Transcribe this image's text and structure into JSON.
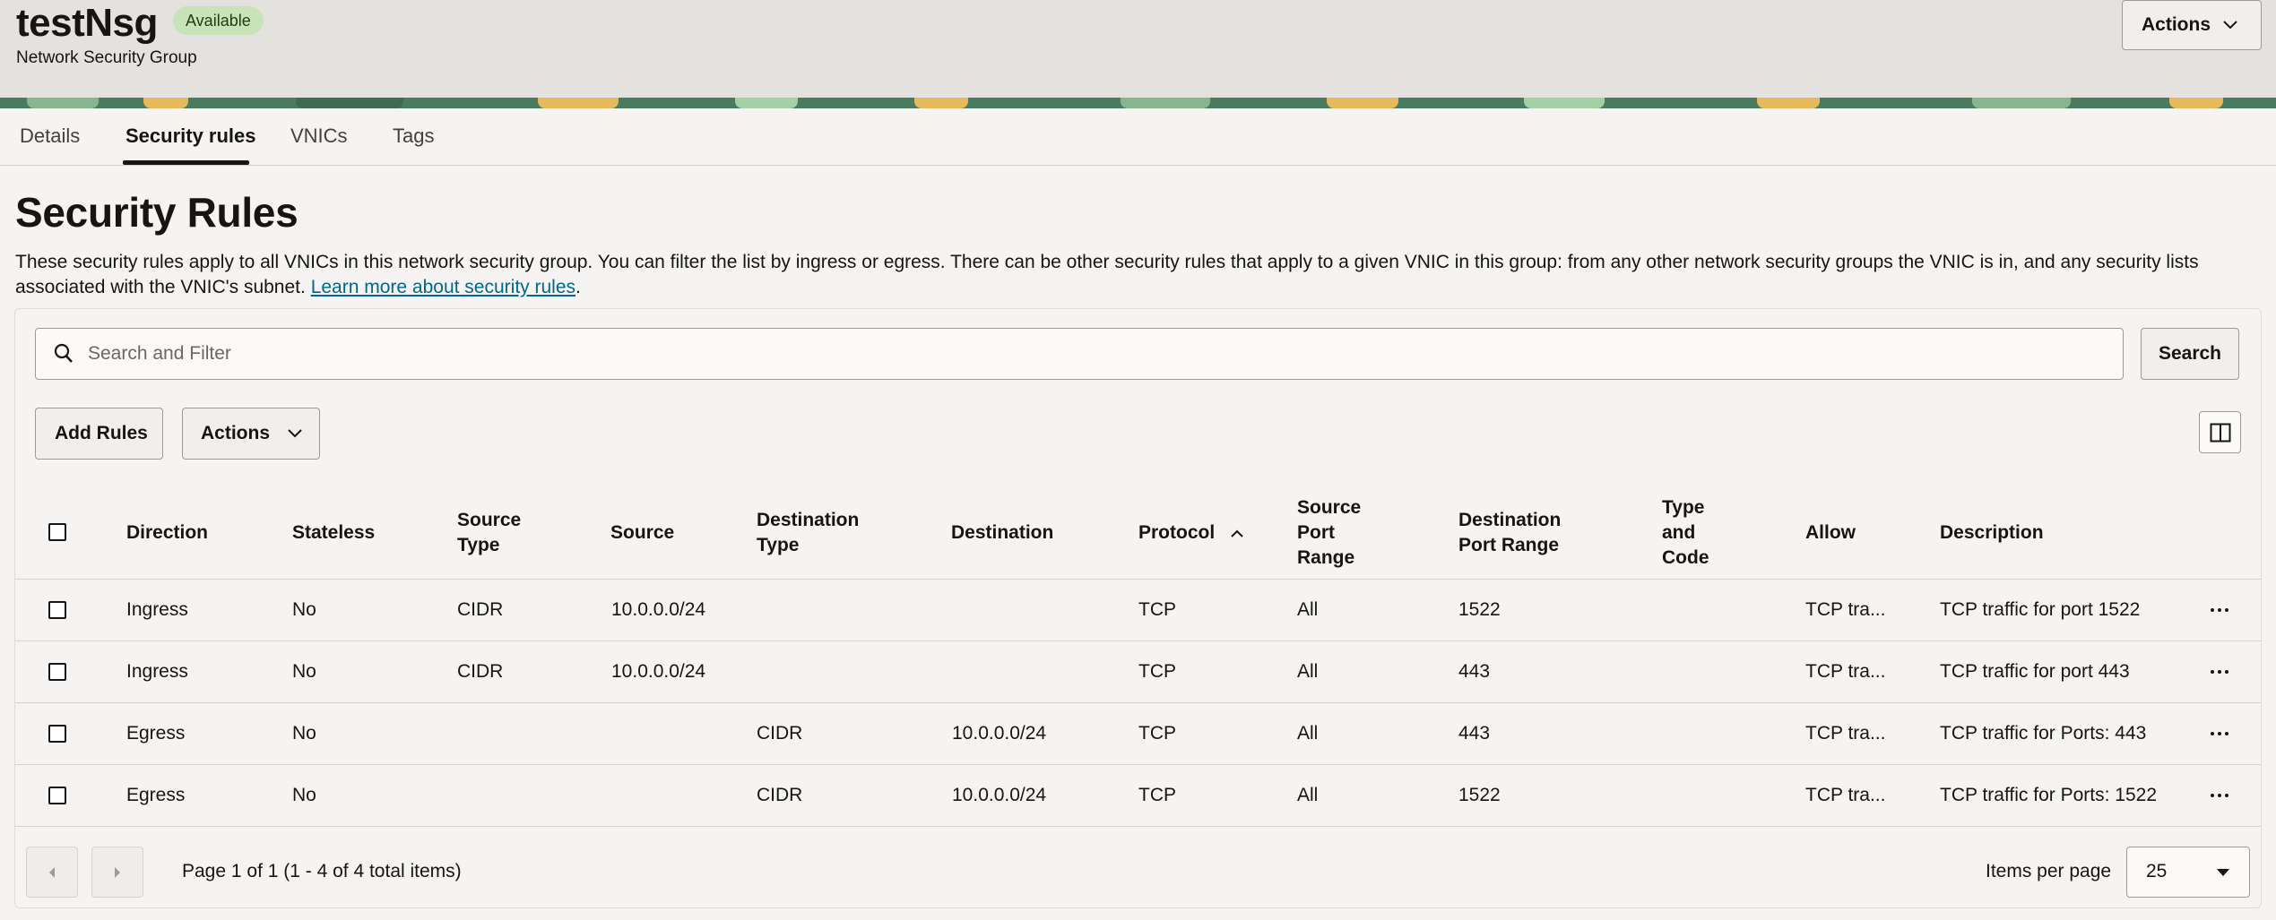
{
  "header": {
    "title": "testNsg",
    "status": "Available",
    "subtitle": "Network Security Group",
    "actions_label": "Actions"
  },
  "tabs": [
    {
      "label": "Details",
      "active": false
    },
    {
      "label": "Security rules",
      "active": true
    },
    {
      "label": "VNICs",
      "active": false
    },
    {
      "label": "Tags",
      "active": false
    }
  ],
  "section": {
    "title": "Security Rules",
    "description": "These security rules apply to all VNICs in this network security group. You can filter the list by ingress or egress. There can be other security rules that apply to a given VNIC in this group: from any other network security groups the VNIC is in, and any security lists associated with the VNIC's subnet.",
    "link_text": "Learn more about security rules",
    "after_link": "."
  },
  "search": {
    "placeholder": "Search and Filter",
    "value": "",
    "button_label": "Search",
    "icon": "search-icon"
  },
  "toolbar": {
    "add_rules_label": "Add Rules",
    "actions_label": "Actions",
    "columns_icon": "columns-icon"
  },
  "table": {
    "columns": {
      "direction": "Direction",
      "stateless": "Stateless",
      "source_type_1": "Source",
      "source_type_2": "Type",
      "source": "Source",
      "dest_type_1": "Destination",
      "dest_type_2": "Type",
      "destination": "Destination",
      "protocol": "Protocol",
      "src_port_1": "Source",
      "src_port_2": "Port",
      "src_port_3": "Range",
      "dst_port_1": "Destination",
      "dst_port_2": "Port Range",
      "type_code_1": "Type",
      "type_code_2": "and",
      "type_code_3": "Code",
      "allow": "Allow",
      "description": "Description"
    },
    "sort": {
      "column": "Protocol",
      "direction": "ascending"
    },
    "rows": [
      {
        "direction": "Ingress",
        "stateless": "No",
        "source_type": "CIDR",
        "source": "10.0.0.0/24",
        "dest_type": "",
        "destination": "",
        "protocol": "TCP",
        "src_port": "All",
        "dst_port": "1522",
        "type_code": "",
        "allow": "TCP tra...",
        "description": "TCP traffic for port 1522"
      },
      {
        "direction": "Ingress",
        "stateless": "No",
        "source_type": "CIDR",
        "source": "10.0.0.0/24",
        "dest_type": "",
        "destination": "",
        "protocol": "TCP",
        "src_port": "All",
        "dst_port": "443",
        "type_code": "",
        "allow": "TCP tra...",
        "description": "TCP traffic for port 443"
      },
      {
        "direction": "Egress",
        "stateless": "No",
        "source_type": "",
        "source": "",
        "dest_type": "CIDR",
        "destination": "10.0.0.0/24",
        "protocol": "TCP",
        "src_port": "All",
        "dst_port": "443",
        "type_code": "",
        "allow": "TCP tra...",
        "description": "TCP traffic for Ports: 443"
      },
      {
        "direction": "Egress",
        "stateless": "No",
        "source_type": "",
        "source": "",
        "dest_type": "CIDR",
        "destination": "10.0.0.0/24",
        "protocol": "TCP",
        "src_port": "All",
        "dst_port": "1522",
        "type_code": "",
        "allow": "TCP tra...",
        "description": "TCP traffic for Ports: 1522"
      }
    ]
  },
  "pagination": {
    "summary": "Page 1 of 1 (1 - 4 of 4 total items)",
    "items_per_page_label": "Items per page",
    "items_per_page": "25"
  }
}
